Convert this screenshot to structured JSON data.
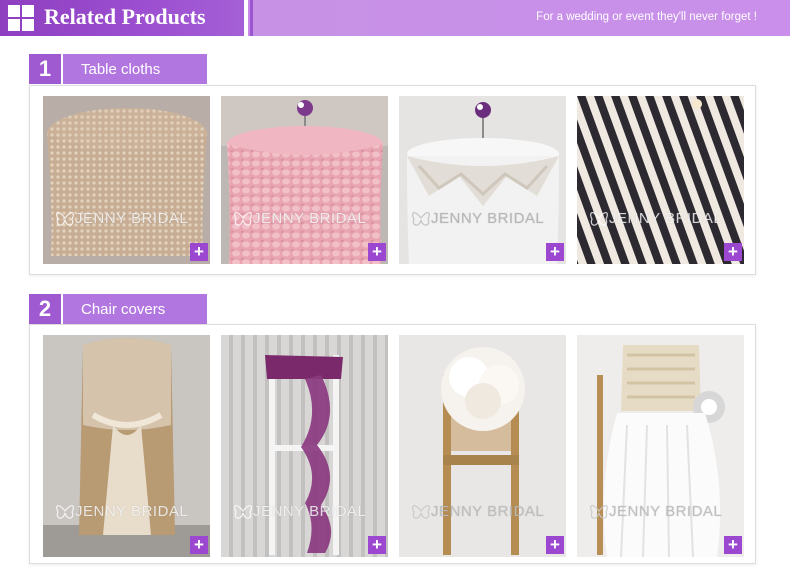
{
  "header": {
    "title": "Related Products",
    "tagline": "For a wedding or event they'll never forget !"
  },
  "sections": [
    {
      "number": "1",
      "label": "Table cloths",
      "items": [
        {
          "name": "champagne sequin round tablecloth",
          "watermark": "JENNY BRIDAL"
        },
        {
          "name": "pink petal taffeta tablecloth",
          "watermark": "JENNY BRIDAL"
        },
        {
          "name": "white lace overlay tablecloth",
          "watermark": "JENNY BRIDAL"
        },
        {
          "name": "black and white striped tablecloth",
          "watermark": "JENNY BRIDAL"
        }
      ]
    },
    {
      "number": "2",
      "label": "Chair covers",
      "items": [
        {
          "name": "gold chair cover with lace sash",
          "watermark": "JENNY BRIDAL"
        },
        {
          "name": "plum ruffle chair sash",
          "watermark": "JENNY BRIDAL"
        },
        {
          "name": "ivory flower chair cap",
          "watermark": "JENNY BRIDAL"
        },
        {
          "name": "ivory tulle chair skirt with rosette",
          "watermark": "JENNY BRIDAL"
        }
      ]
    }
  ],
  "colors": {
    "accent_purple": "#9b47d0",
    "banner_light": "#c88ae8",
    "label_bg": "#b276e0"
  },
  "icons": {
    "header": "grid-icon",
    "add": "plus-icon"
  }
}
